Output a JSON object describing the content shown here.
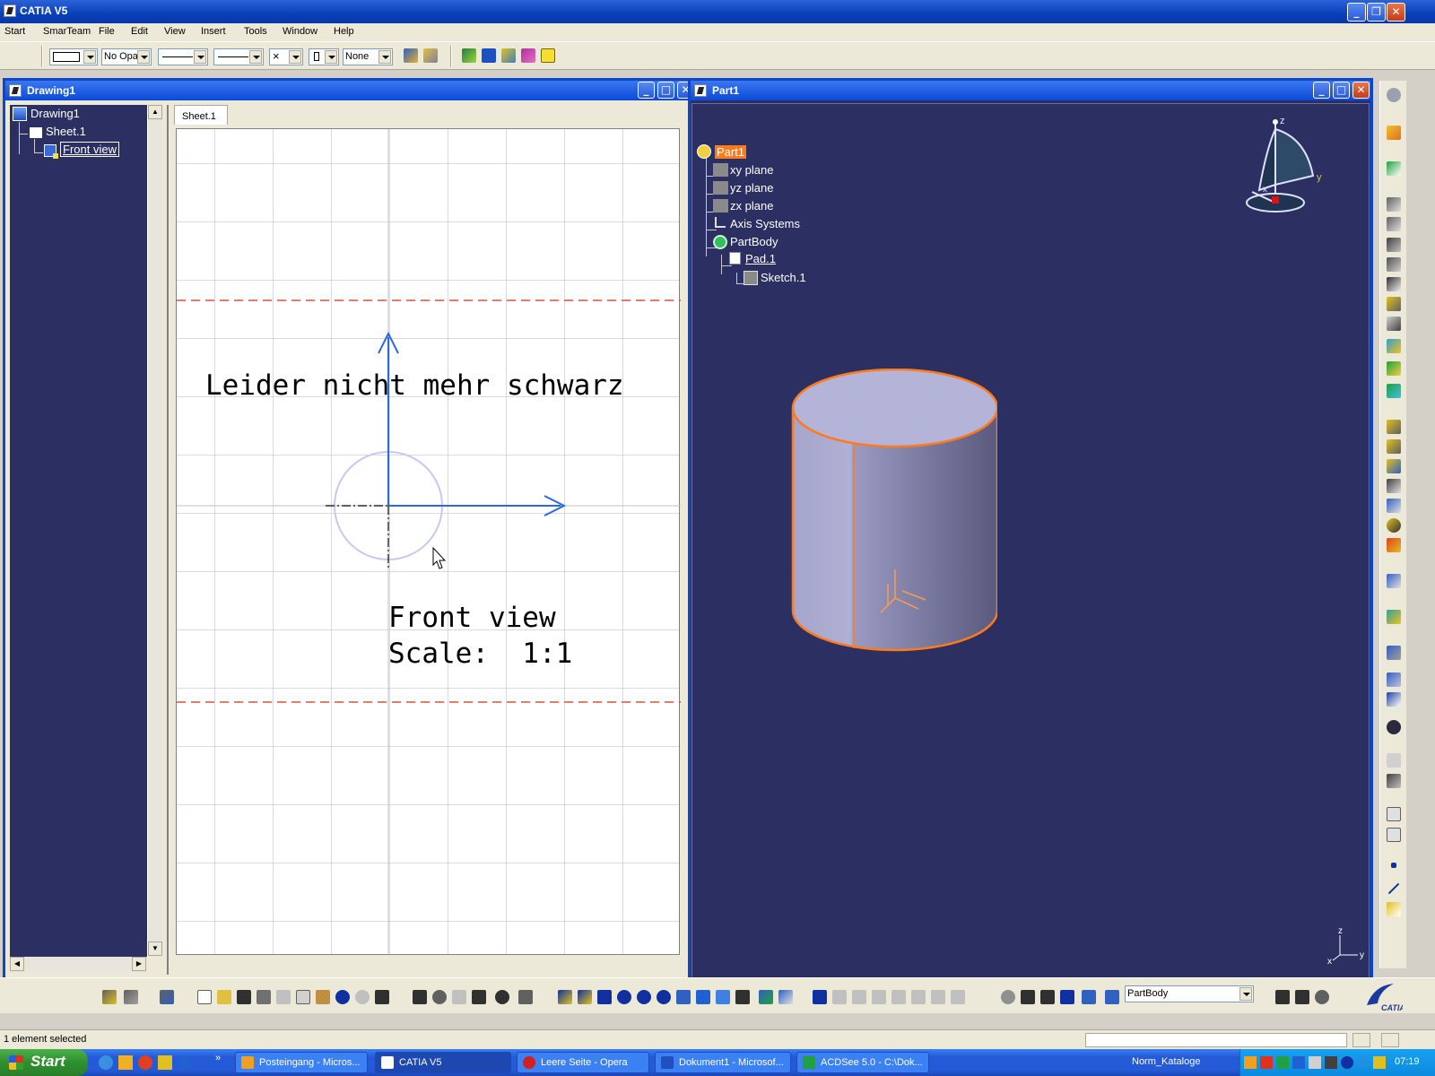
{
  "app": {
    "title": "CATIA V5"
  },
  "menu": [
    "Start",
    "SmarTeam",
    "File",
    "Edit",
    "View",
    "Insert",
    "Tools",
    "Window",
    "Help"
  ],
  "format_toolbar": {
    "opacity": "No Opa",
    "pattern": "None"
  },
  "drawing_window": {
    "title": "Drawing1",
    "tree": {
      "root": "Drawing1",
      "sheet": "Sheet.1",
      "view": "Front view"
    },
    "sheet_tab": "Sheet.1",
    "annotation": "Leider nicht mehr schwarz",
    "view_label": "Front view",
    "scale_label": "Scale:  1:1"
  },
  "part_window": {
    "title": "Part1",
    "tree": {
      "root": "Part1",
      "items": [
        "xy plane",
        "yz plane",
        "zx plane",
        "Axis Systems",
        "PartBody",
        "Pad.1",
        "Sketch.1"
      ]
    },
    "compass": {
      "z": "z",
      "y": "y",
      "x": "x"
    },
    "axis": {
      "z": "z",
      "x": "x",
      "y": "y"
    },
    "colors": {
      "background": "#2b2f61",
      "highlight": "#ff7a1a",
      "solid": "#b4b4d8"
    }
  },
  "bottom_toolbar": {
    "body_select": "PartBody"
  },
  "status": {
    "text": "1 element selected"
  },
  "taskbar": {
    "start": "Start",
    "tasks": [
      "Posteingang - Micros...",
      "CATIA V5",
      "Leere Seite - Opera",
      "Dokument1 - Microsof...",
      "ACDSee 5.0 - C:\\Dok..."
    ],
    "tray_label": "Norm_Kataloge",
    "clock": "07:19"
  },
  "icons": {
    "cursor": "mouse-pointer-icon",
    "brand": "catia-logo"
  }
}
